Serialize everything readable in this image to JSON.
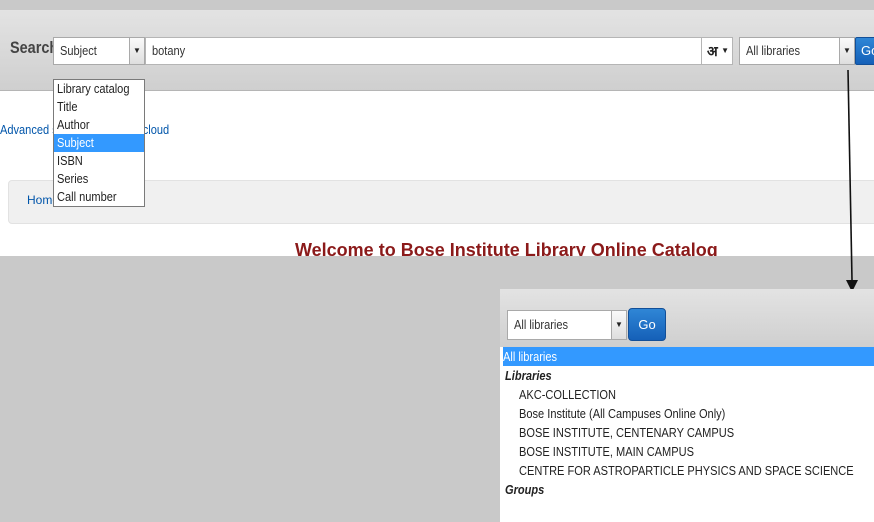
{
  "search": {
    "label": "Search",
    "index_select": "Subject",
    "query": "botany",
    "lang_button": "अ",
    "library_select": "All libraries",
    "go_label": "Go"
  },
  "index_dropdown": {
    "options": [
      "Library catalog",
      "Title",
      "Author",
      "Subject",
      "ISBN",
      "Series",
      "Call number"
    ],
    "selected": "Subject"
  },
  "links": {
    "advanced": "Advanced search",
    "search_suffix": "earch",
    "separator": " | ",
    "tag_cloud": "Tag cloud"
  },
  "breadcrumb": {
    "home": "Home"
  },
  "welcome": "Welcome to Bose Institute Library Online Catalog",
  "library_panel": {
    "select_value": "All libraries",
    "go_label": "Go",
    "options": {
      "all": "All libraries",
      "libraries_group": "Libraries",
      "libraries": [
        "AKC-COLLECTION",
        "Bose Institute (All Campuses Online Only)",
        "BOSE INSTITUTE, CENTENARY CAMPUS",
        "BOSE INSTITUTE, MAIN CAMPUS",
        "CENTRE FOR ASTROPARTICLE PHYSICS AND SPACE SCIENCE"
      ],
      "groups_group": "Groups"
    }
  },
  "colors": {
    "accent": "#3399ff",
    "go_button": "#1f6fc6",
    "link": "#0055aa",
    "heading": "#8b1a1a",
    "background": "#c9c9c9"
  }
}
